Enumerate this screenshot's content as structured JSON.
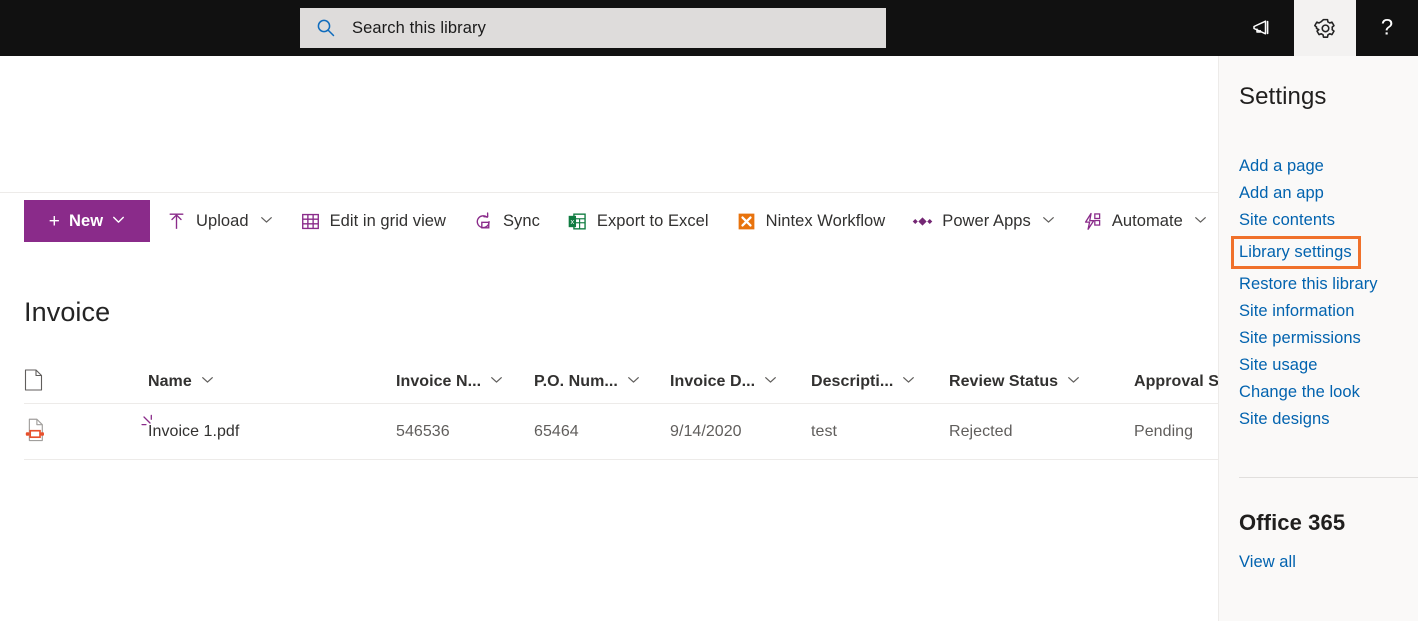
{
  "suitebar": {
    "search": {
      "placeholder": "Search this library",
      "value": "",
      "icon": "search-icon"
    },
    "actions": [
      {
        "name": "megaphone-icon",
        "label": "Feedback",
        "active": false
      },
      {
        "name": "gear-icon",
        "label": "Settings",
        "active": true
      },
      {
        "name": "help-icon",
        "label": "Help",
        "active": false
      }
    ]
  },
  "commandbar": {
    "new": {
      "label": "New",
      "plus": "+",
      "has_chevron": true,
      "color": "#8a2b8a"
    },
    "commands": [
      {
        "label": "Upload",
        "icon": "upload-icon",
        "has_chevron": true
      },
      {
        "label": "Edit in grid view",
        "icon": "grid-icon",
        "has_chevron": false
      },
      {
        "label": "Sync",
        "icon": "sync-icon",
        "has_chevron": false
      },
      {
        "label": "Export to Excel",
        "icon": "excel-icon",
        "has_chevron": false
      },
      {
        "label": "Nintex Workflow",
        "icon": "nintex-icon",
        "has_chevron": false
      },
      {
        "label": "Power Apps",
        "icon": "powerapps-icon",
        "has_chevron": true
      },
      {
        "label": "Automate",
        "icon": "automate-icon",
        "has_chevron": true
      }
    ]
  },
  "page": {
    "title": "Invoice"
  },
  "list": {
    "columns": [
      {
        "label": "Name",
        "has_chevron": true
      },
      {
        "label": "Invoice N...",
        "has_chevron": true
      },
      {
        "label": "P.O. Num...",
        "has_chevron": true
      },
      {
        "label": "Invoice D...",
        "has_chevron": true
      },
      {
        "label": "Descripti...",
        "has_chevron": true
      },
      {
        "label": "Review Status",
        "has_chevron": true
      },
      {
        "label": "Approval S",
        "has_chevron": false
      }
    ],
    "rows": [
      {
        "file_icon": "pdf-file-icon",
        "is_new": true,
        "name": "Invoice 1.pdf",
        "invoice_number": "546536",
        "po_number": "65464",
        "invoice_date": "9/14/2020",
        "description": "test",
        "review_status": "Rejected",
        "approval_status": "Pending"
      }
    ]
  },
  "settings_panel": {
    "title": "Settings",
    "links": [
      {
        "label": "Add a page",
        "highlighted": false
      },
      {
        "label": "Add an app",
        "highlighted": false
      },
      {
        "label": "Site contents",
        "highlighted": false
      },
      {
        "label": "Library settings",
        "highlighted": true
      },
      {
        "label": "Restore this library",
        "highlighted": false
      },
      {
        "label": "Site information",
        "highlighted": false
      },
      {
        "label": "Site permissions",
        "highlighted": false
      },
      {
        "label": "Site usage",
        "highlighted": false
      },
      {
        "label": "Change the look",
        "highlighted": false
      },
      {
        "label": "Site designs",
        "highlighted": false
      }
    ],
    "subtitle": "Office 365",
    "view_all": "View all",
    "highlight_color": "#f0712b",
    "link_color": "#0263af"
  }
}
